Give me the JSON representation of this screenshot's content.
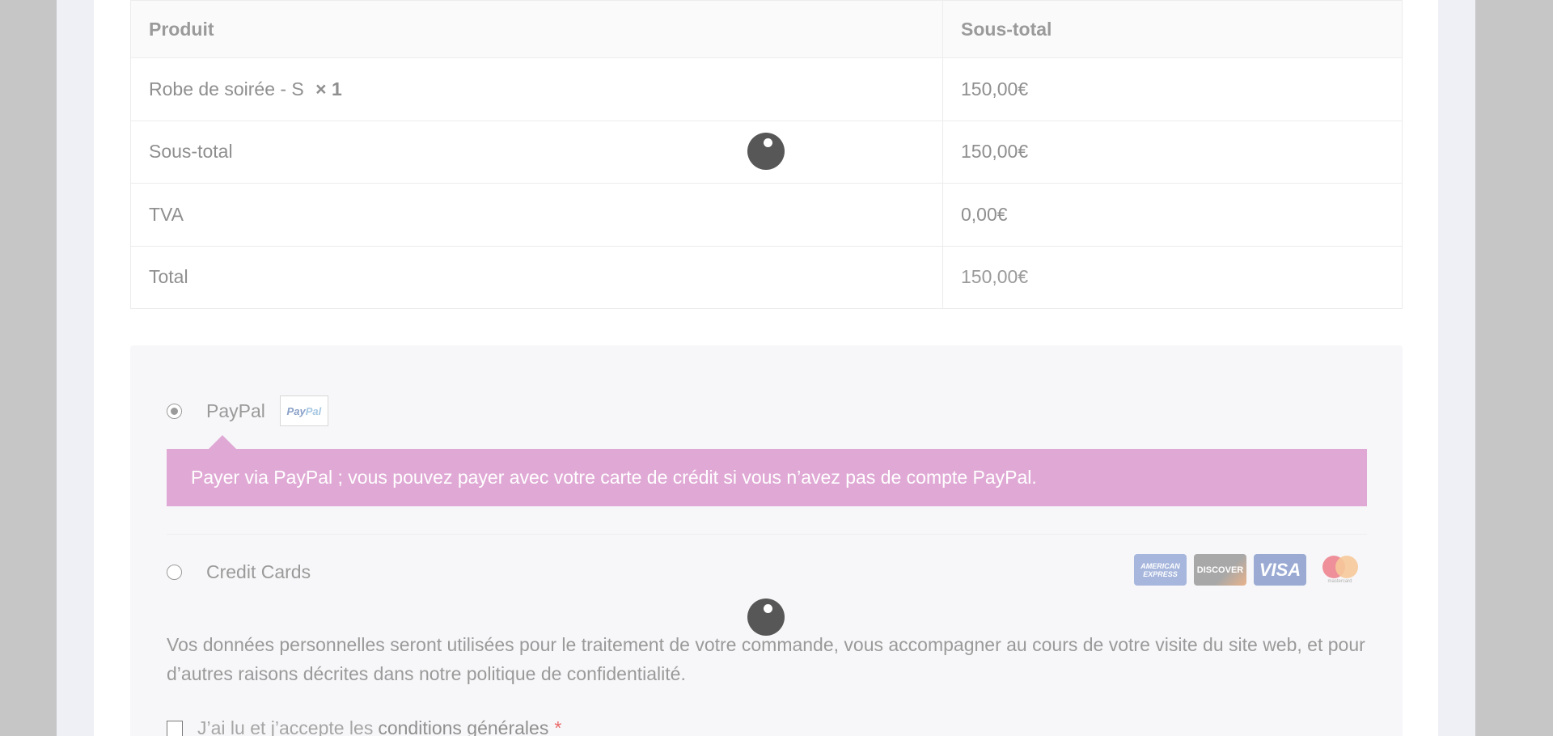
{
  "order": {
    "headers": {
      "product": "Produit",
      "subtotal": "Sous-total"
    },
    "item": {
      "name": "Robe de soirée - S",
      "qty": "× 1",
      "price": "150,00€"
    },
    "rows": [
      {
        "label": "Sous-total",
        "value": "150,00€"
      },
      {
        "label": "TVA",
        "value": "0,00€"
      },
      {
        "label": "Total",
        "value": "150,00€"
      }
    ]
  },
  "payment": {
    "paypal": {
      "label": "PayPal",
      "logo_text_pay": "Pay",
      "logo_text_pal": "Pal",
      "description": "Payer via PayPal ; vous pouvez payer avec votre carte de crédit si vous n’avez pas de compte PayPal.",
      "selected": true
    },
    "credit_cards": {
      "label": "Credit Cards",
      "selected": false,
      "icons": [
        {
          "name": "amex-icon",
          "text": "AMERICAN EXPRESS"
        },
        {
          "name": "discover-icon",
          "text": "DISCOVER"
        },
        {
          "name": "visa-icon",
          "text": "VISA"
        },
        {
          "name": "mastercard-icon",
          "text": "mastercard"
        }
      ]
    }
  },
  "privacy_text": "Vos données personnelles seront utilisées pour le traitement de votre commande, vous accompagner au cours de votre visite du site web, et pour d’autres raisons décrites dans notre politique de confidentialité.",
  "terms": {
    "prefix": "J’ai lu et j’accepte les",
    "link": "conditions générales",
    "required_mark": "*"
  },
  "colors": {
    "accent_pink": "#e0a9d5",
    "required_red": "#ea6b6b"
  }
}
